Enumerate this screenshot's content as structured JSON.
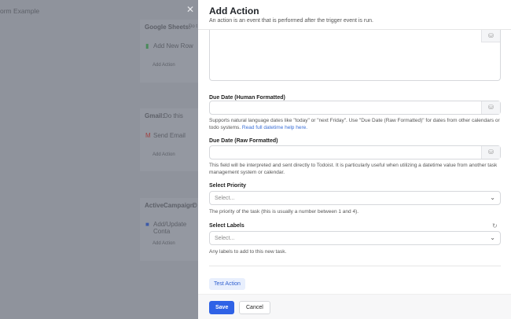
{
  "background": {
    "page_title": "orm Example",
    "steps": [
      {
        "app": "Google Sheets:",
        "desc": "Do t",
        "action": "Add New Row",
        "add": "Add Action"
      },
      {
        "app": "Gmail:",
        "desc": "Do this",
        "action": "Send Email",
        "add": "Add Action"
      },
      {
        "app": "ActiveCampaign:",
        "desc": "D",
        "action": "Add/Update Conta",
        "add": "Add Action"
      }
    ]
  },
  "panel": {
    "title": "Add Action",
    "subtitle": "An action is an event that is performed after the trigger event is run.",
    "fields": [
      {
        "label": "Due Date (Human Formatted)",
        "help": "Supports natural language dates like \"today\" or \"next Friday\". Use \"Due Date (Raw Formatted)\" for dates from other calendars or todo systems.",
        "link": "Read full datetime help here."
      },
      {
        "label": "Due Date (Raw Formatted)",
        "help": "This field will be interpreted and sent directly to Todoist. It is particularly useful when utilizing a datetime value from another task management system or calendar."
      },
      {
        "label": "Select Priority",
        "placeholder": "Select...",
        "help": "The priority of the task (this is usually a number between 1 and 4)."
      },
      {
        "label": "Select Labels",
        "placeholder": "Select...",
        "help": "Any labels to add to this new task."
      }
    ],
    "test_label": "Test Action",
    "save_label": "Save",
    "cancel_label": "Cancel"
  }
}
